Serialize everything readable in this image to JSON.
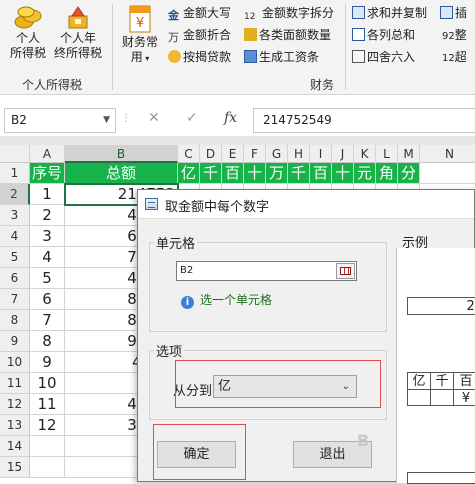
{
  "ribbon": {
    "personal_tax": "个人\n所得税",
    "year_end_tax": "个人年\n终所得税",
    "finance_common": "财务常\n用",
    "group_tax": "个人所得税",
    "group_finance": "财务",
    "items_col1": [
      "金额大写",
      "金额折合",
      "按揭贷款"
    ],
    "items_col2": [
      "金额数字拆分",
      "各类面额数量",
      "生成工资条"
    ],
    "items_col3": [
      "求和并复制",
      "各列总和",
      "四舍六入"
    ],
    "items_col4": [
      "插",
      "整",
      "超"
    ],
    "item_col4_prefixes": [
      "",
      "92",
      "12"
    ]
  },
  "formula_bar": {
    "cell_ref": "B2",
    "formula": "214752549"
  },
  "sheet": {
    "columns": [
      "A",
      "B",
      "C",
      "D",
      "E",
      "F",
      "G",
      "H",
      "I",
      "J",
      "K",
      "L",
      "M",
      "N"
    ],
    "rows": [
      "1",
      "2",
      "3",
      "4",
      "5",
      "6",
      "7",
      "8",
      "9",
      "10",
      "11",
      "12",
      "13",
      "14",
      "15"
    ],
    "header_row": [
      "序号",
      "总额",
      "亿",
      "千",
      "百",
      "十",
      "万",
      "千",
      "百",
      "十",
      "元",
      "角",
      "分"
    ],
    "data": [
      [
        "1",
        "214752"
      ],
      [
        "2",
        "46616"
      ],
      [
        "3",
        "61141"
      ],
      [
        "4",
        "71094"
      ],
      [
        "5",
        "49229"
      ],
      [
        "6",
        "84601"
      ],
      [
        "7",
        "87890"
      ],
      [
        "8",
        "93213"
      ],
      [
        "9",
        "458.8"
      ],
      [
        "10",
        "3332"
      ],
      [
        "11",
        "40411"
      ],
      [
        "12",
        "35579"
      ]
    ]
  },
  "dialog": {
    "title": "取金额中每个数字",
    "cell_group": "单元格",
    "cell_value": "B2",
    "hint": "选一个单元格",
    "options_group": "选项",
    "range_label": "从分到",
    "range_value": "亿",
    "ok": "确定",
    "cancel": "退出",
    "preview_group": "示例",
    "preview_value": "23",
    "preview_headers": [
      "亿",
      "千",
      "百"
    ],
    "preview_currency": "¥",
    "watermark": "B"
  },
  "colors": {
    "header_green": "#17b24a",
    "selection_green": "#217346",
    "highlight_red": "#e24a4a"
  }
}
